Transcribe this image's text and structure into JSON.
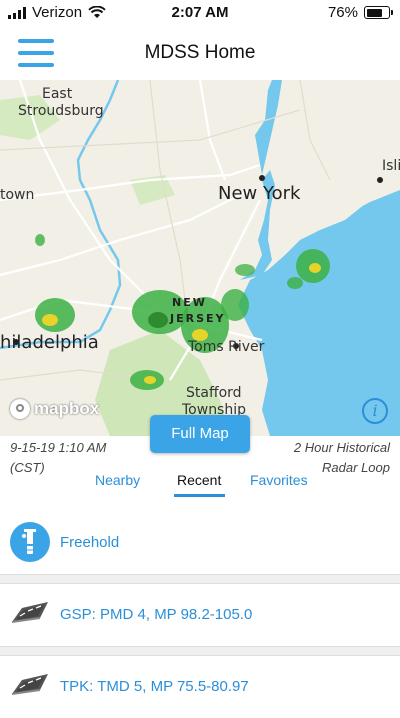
{
  "status": {
    "carrier": "Verizon",
    "time": "2:07 AM",
    "battery": "76%"
  },
  "header": {
    "title": "MDSS Home"
  },
  "map": {
    "labels": {
      "east": "East",
      "stroudsburg": "Stroudsburg",
      "town": "town",
      "new_york": "New York",
      "isli": "Isli",
      "new": "NEW",
      "jersey": "JERSEY",
      "philadelphia": "hiladelphia",
      "toms_river": "Toms River",
      "stafford": "Stafford",
      "township": "Township"
    },
    "logo": "mapbox",
    "info": "i"
  },
  "radar": {
    "full_map_label": "Full Map",
    "timestamp_line1": "9-15-19 1:10 AM",
    "timestamp_line2": "(CST)",
    "loop_line1": "2 Hour Historical",
    "loop_line2": "Radar Loop"
  },
  "tabs": [
    {
      "label": "Nearby"
    },
    {
      "label": "Recent",
      "active": true
    },
    {
      "label": "Favorites"
    }
  ],
  "list": [
    {
      "label": "Freehold",
      "icon": "weather-station-icon"
    },
    {
      "label": "GSP: PMD 4, MP 98.2-105.0",
      "icon": "road-icon"
    },
    {
      "label": "TPK: TMD 5, MP 75.5-80.97",
      "icon": "road-icon"
    }
  ],
  "colors": {
    "accent": "#3aa4e6",
    "link": "#2b8fd8",
    "water": "#74c8ee",
    "land": "#f2efe6"
  }
}
